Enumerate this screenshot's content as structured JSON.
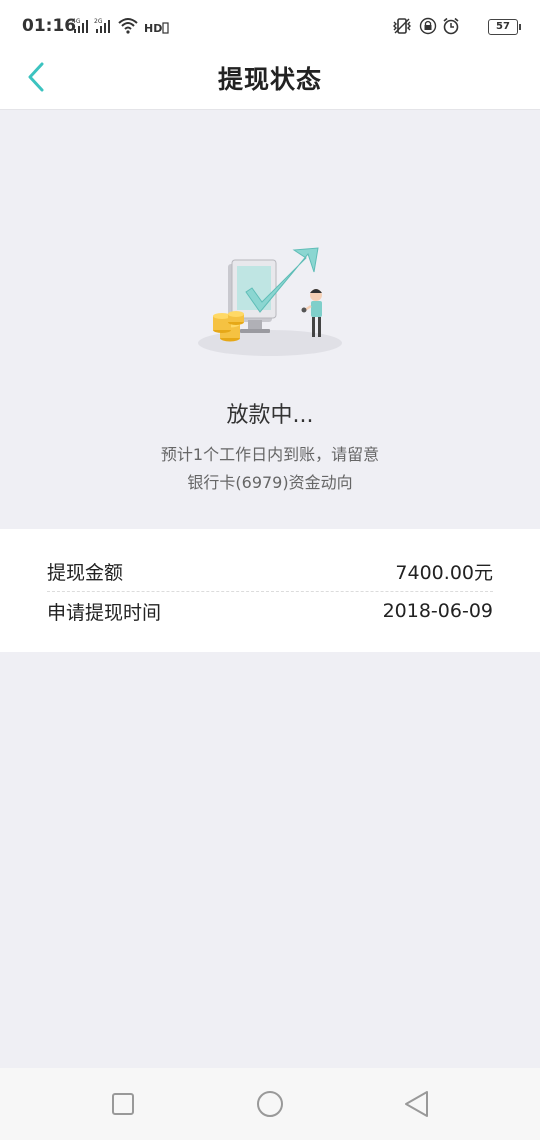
{
  "status_bar": {
    "time": "01:16",
    "battery": "57",
    "icons": [
      "signal-4g-icon",
      "signal-2g-icon",
      "wifi-icon",
      "hd-icon",
      "vibrate-icon",
      "lock-icon",
      "alarm-icon",
      "battery-icon"
    ]
  },
  "header": {
    "title": "提现状态",
    "back_icon": "chevron-left-icon"
  },
  "status": {
    "heading": "放款中...",
    "description_line1": "预计1个工作日内到账，请留意",
    "description_line2": "银行卡(6979)资金动向"
  },
  "details": {
    "rows": [
      {
        "label": "提现金额",
        "value": "7400.00元"
      },
      {
        "label": "申请提现时间",
        "value": "2018-06-09"
      }
    ]
  },
  "system_nav": {
    "buttons": [
      "recent-apps-icon",
      "home-icon",
      "back-triangle-icon"
    ]
  },
  "colors": {
    "accent": "#3cc3c0",
    "background": "#efeff4",
    "text": "#222222"
  }
}
